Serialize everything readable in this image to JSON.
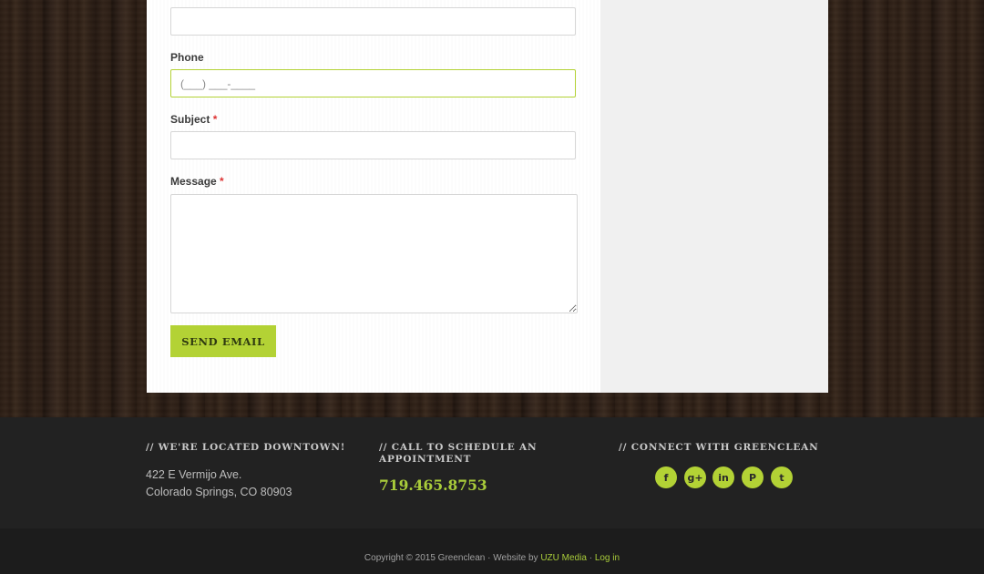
{
  "form": {
    "phone_label": "Phone",
    "phone_placeholder": "(___) ___-____",
    "subject_label": "Subject",
    "message_label": "Message",
    "required_mark": "*",
    "send_button": "SEND EMAIL"
  },
  "footer": {
    "location": {
      "heading": "//  WE'RE LOCATED DOWNTOWN!",
      "address_line1": "422 E Vermijo Ave.",
      "address_line2": "Colorado Springs, CO 80903"
    },
    "schedule": {
      "heading_line1": "//  CALL TO SCHEDULE AN",
      "heading_line2": "APPOINTMENT",
      "phone": "719.465.8753"
    },
    "connect": {
      "heading": "//  CONNECT WITH GREENCLEAN",
      "social": [
        {
          "icon": "facebook-icon",
          "glyph": "f"
        },
        {
          "icon": "google-plus-icon",
          "glyph": "g+"
        },
        {
          "icon": "linkedin-icon",
          "glyph": "in"
        },
        {
          "icon": "pinterest-icon",
          "glyph": "P"
        },
        {
          "icon": "twitter-icon",
          "glyph": "t"
        }
      ]
    },
    "copyright": "Copyright © 2015 Greenclean · Website by",
    "uzu_link": "UZU Media",
    "separator": "·",
    "login_link": "Log in"
  },
  "colors": {
    "accent": "#b3d235",
    "footer_bg": "#222222"
  }
}
